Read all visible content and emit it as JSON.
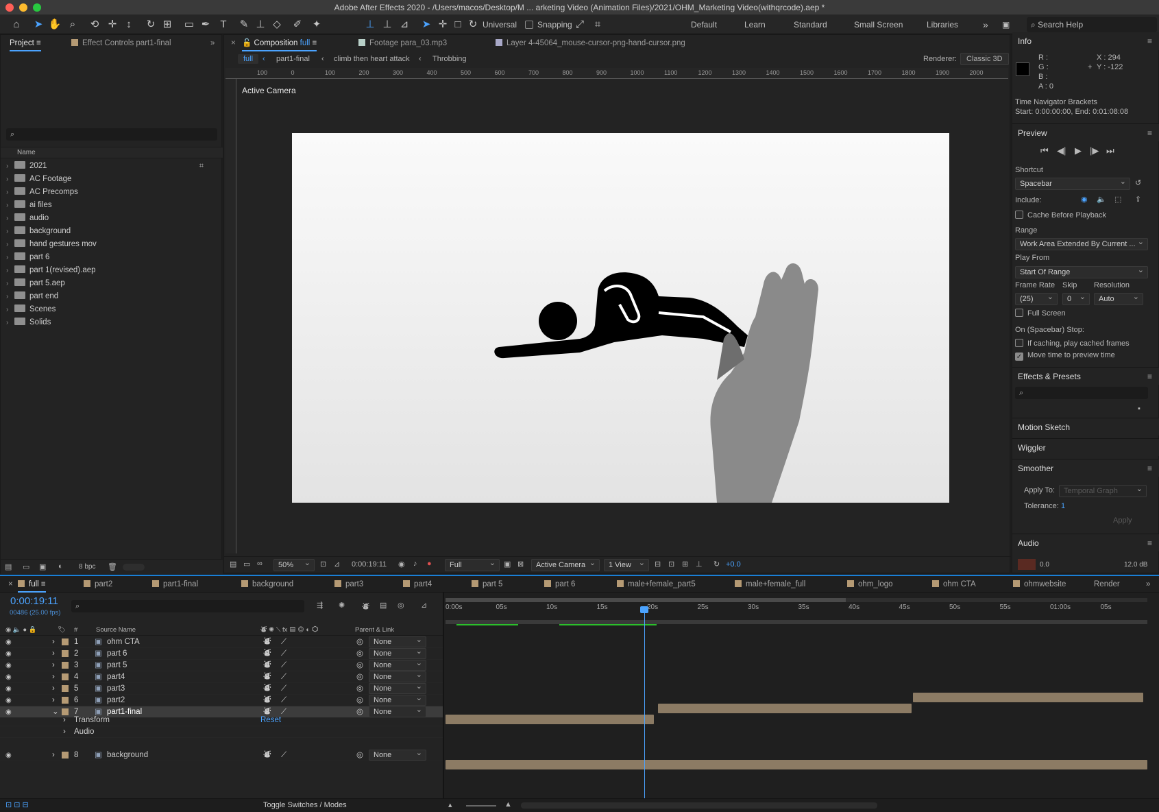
{
  "app": {
    "window_title": "Adobe After Effects 2020 - /Users/macos/Desktop/M ... arketing Video (Animation Files)/2021/OHM_Marketing Video(withqrcode).aep *"
  },
  "toolbar": {
    "universal_label": "Universal",
    "snapping_label": "Snapping",
    "workspaces": [
      "Default",
      "Learn",
      "Standard",
      "Small Screen",
      "Libraries"
    ],
    "search_placeholder": "Search Help"
  },
  "project_panel": {
    "tab_project": "Project",
    "tab_effect_controls": "Effect Controls part1-final",
    "column_name": "Name",
    "items": [
      "2021",
      "AC Footage",
      "AC Precomps",
      "ai files",
      "audio",
      "background",
      "hand gestures mov",
      "part 6",
      "part 1(revised).aep",
      "part 5.aep",
      "part end",
      "Scenes",
      "Solids"
    ],
    "bpc": "8 bpc"
  },
  "composition": {
    "tab_comp_prefix": "Composition",
    "tab_comp_name": "full",
    "tab_footage": "Footage para_03.mp3",
    "tab_layer": "Layer 4-45064_mouse-cursor-png-hand-cursor.png",
    "breadcrumbs": [
      "full",
      "part1-final",
      "climb then heart attack",
      "Throbbing"
    ],
    "renderer_label": "Renderer:",
    "renderer_value": "Classic 3D",
    "active_camera_label": "Active Camera",
    "ruler_ticks": [
      "100",
      "0",
      "100",
      "200",
      "300",
      "400",
      "500",
      "600",
      "700",
      "800",
      "900",
      "1000",
      "1100",
      "1200",
      "1300",
      "1400",
      "1500",
      "1600",
      "1700",
      "1800",
      "1900",
      "2000"
    ],
    "footer": {
      "zoom": "50%",
      "timecode": "0:00:19:11",
      "resolution": "Full",
      "camera": "Active Camera",
      "views": "1 View",
      "exposure": "+0.0"
    }
  },
  "info_panel": {
    "title": "Info",
    "r": "R :",
    "g": "G :",
    "b": "B :",
    "a": "A : 0",
    "x": "X : 294",
    "y": "Y : -122",
    "nav_title": "Time Navigator Brackets",
    "nav_range": "Start: 0:00:00:00, End: 0:01:08:08"
  },
  "preview_panel": {
    "title": "Preview",
    "shortcut_label": "Shortcut",
    "shortcut_value": "Spacebar",
    "include_label": "Include:",
    "cache_label": "Cache Before Playback",
    "range_label": "Range",
    "range_value": "Work Area Extended By Current ...",
    "play_from_label": "Play From",
    "play_from_value": "Start Of Range",
    "frame_rate_label": "Frame Rate",
    "skip_label": "Skip",
    "resolution_label": "Resolution",
    "frame_rate_value": "(25)",
    "skip_value": "0",
    "resolution_value": "Auto",
    "full_screen_label": "Full Screen",
    "stop_label": "On (Spacebar) Stop:",
    "if_caching_label": "If caching, play cached frames",
    "move_time_label": "Move time to preview time"
  },
  "effects_panel": {
    "title": "Effects & Presets",
    "search_placeholder": ""
  },
  "motion_sketch": {
    "label": "Motion Sketch"
  },
  "wiggler": {
    "label": "Wiggler"
  },
  "smoother": {
    "title": "Smoother",
    "apply_to_label": "Apply To:",
    "apply_to_value": "Temporal Graph",
    "tolerance_label": "Tolerance:",
    "tolerance_value": "1",
    "apply_button": "Apply"
  },
  "audio_panel": {
    "title": "Audio",
    "left_value": "0.0",
    "right_value": "12.0 dB"
  },
  "timeline": {
    "tabs": [
      "full",
      "part2",
      "part1-final",
      "background",
      "part3",
      "part4",
      "part 5",
      "part 6",
      "male+female_part5",
      "male+female_full",
      "ohm_logo",
      "ohm CTA",
      "ohmwebsite"
    ],
    "render_tab": "Render",
    "current_time": "0:00:19:11",
    "frame_info": "00486 (25.00 fps)",
    "col_hash": "#",
    "col_source": "Source Name",
    "col_parent": "Parent & Link",
    "time_ticks": [
      "0:00s",
      "05s",
      "10s",
      "15s",
      "20s",
      "25s",
      "30s",
      "35s",
      "40s",
      "45s",
      "50s",
      "55s",
      "01:00s",
      "05s"
    ],
    "layers": [
      {
        "num": "1",
        "name": "ohm CTA",
        "parent": "None"
      },
      {
        "num": "2",
        "name": "part 6",
        "parent": "None"
      },
      {
        "num": "3",
        "name": "part 5",
        "parent": "None"
      },
      {
        "num": "4",
        "name": "part4",
        "parent": "None"
      },
      {
        "num": "5",
        "name": "part3",
        "parent": "None"
      },
      {
        "num": "6",
        "name": "part2",
        "parent": "None"
      },
      {
        "num": "7",
        "name": "part1-final",
        "parent": "None"
      },
      {
        "num": "8",
        "name": "background",
        "parent": "None"
      }
    ],
    "transform_label": "Transform",
    "reset_label": "Reset",
    "audio_label": "Audio",
    "toggle_label": "Toggle Switches / Modes"
  }
}
